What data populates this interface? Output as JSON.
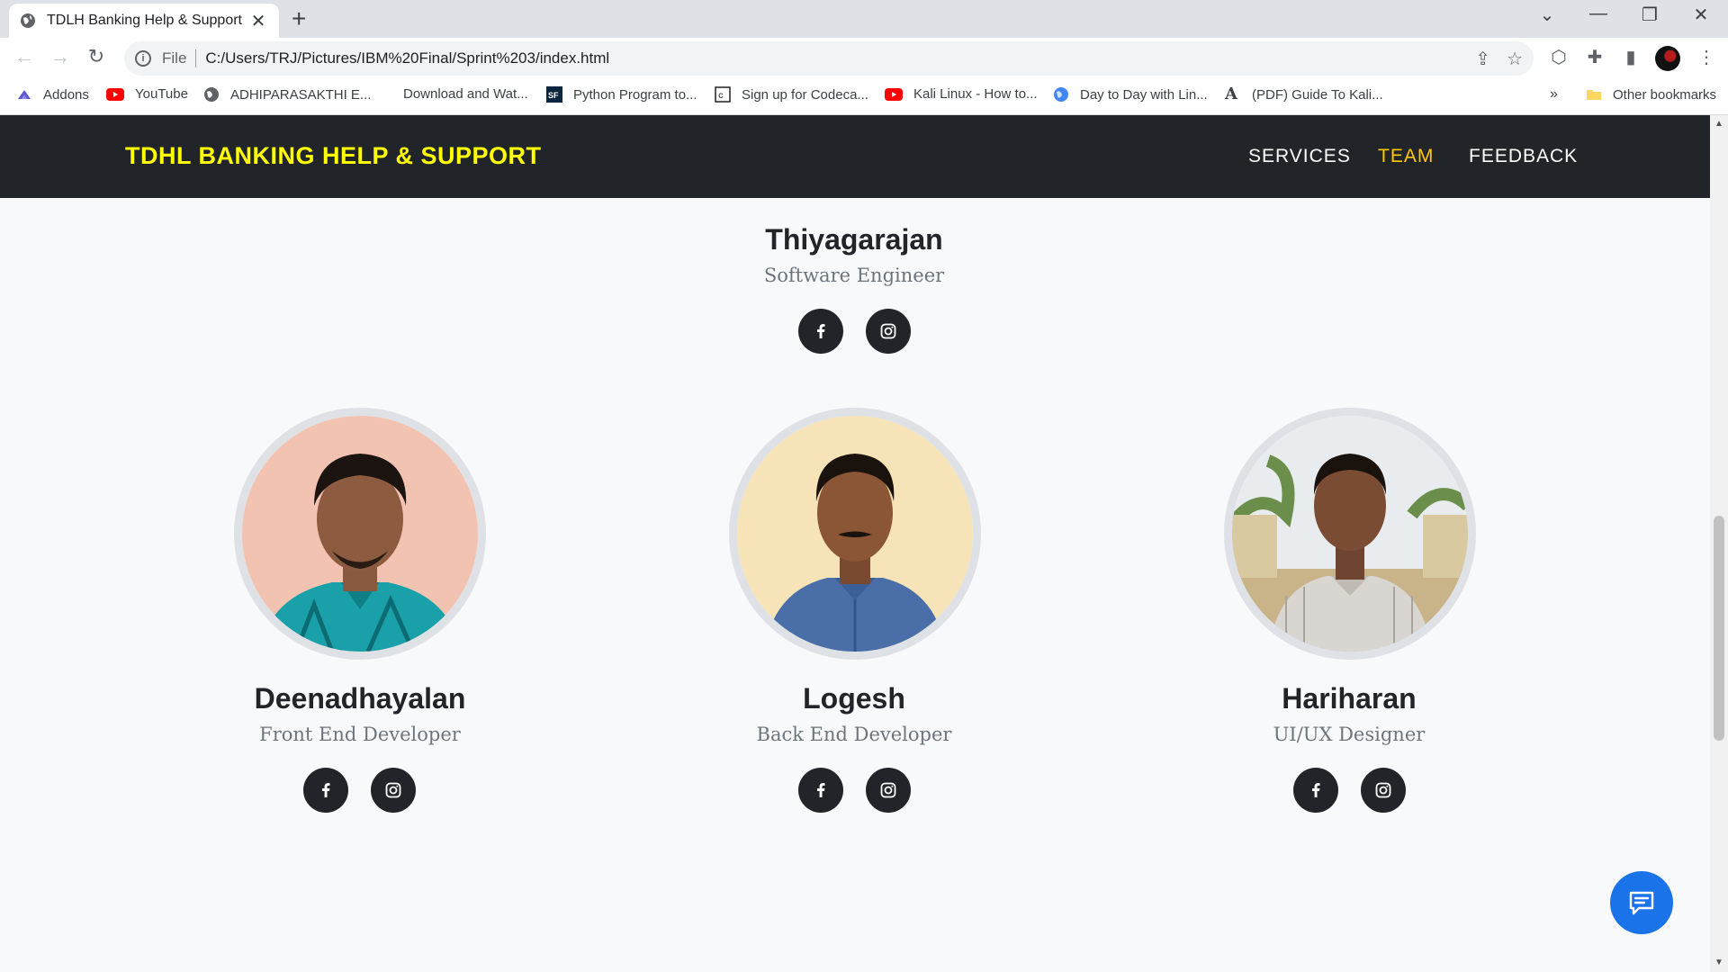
{
  "browser": {
    "tab_title": "TDLH Banking Help & Support",
    "file_label": "File",
    "url": "C:/Users/TRJ/Pictures/IBM%20Final/Sprint%203/index.html"
  },
  "bookmarks": {
    "items": [
      {
        "label": "Addons"
      },
      {
        "label": "YouTube"
      },
      {
        "label": "ADHIPARASAKTHI E..."
      },
      {
        "label": "Download and Wat..."
      },
      {
        "label": "Python Program to..."
      },
      {
        "label": "Sign up for Codeca..."
      },
      {
        "label": "Kali Linux - How to..."
      },
      {
        "label": "Day to Day with Lin..."
      },
      {
        "label": "(PDF) Guide To Kali..."
      }
    ],
    "more": "»",
    "other": "Other bookmarks"
  },
  "navbar": {
    "brand": "TDHL BANKING HELP & SUPPORT",
    "links": [
      "SERVICES",
      "TEAM",
      "FEEDBACK"
    ],
    "active": "TEAM",
    "active_color": "#ffc800",
    "brand_color": "#ffff00"
  },
  "team": {
    "lead": {
      "name": "Thiyagarajan",
      "role": "Software Engineer"
    },
    "members": [
      {
        "name": "Deenadhayalan",
        "role": "Front End Developer"
      },
      {
        "name": "Logesh",
        "role": "Back End Developer"
      },
      {
        "name": "Hariharan",
        "role": "UI/UX Designer"
      }
    ]
  },
  "icons": {
    "social": [
      "facebook-icon",
      "instagram-icon"
    ],
    "chat": "chat-icon"
  }
}
